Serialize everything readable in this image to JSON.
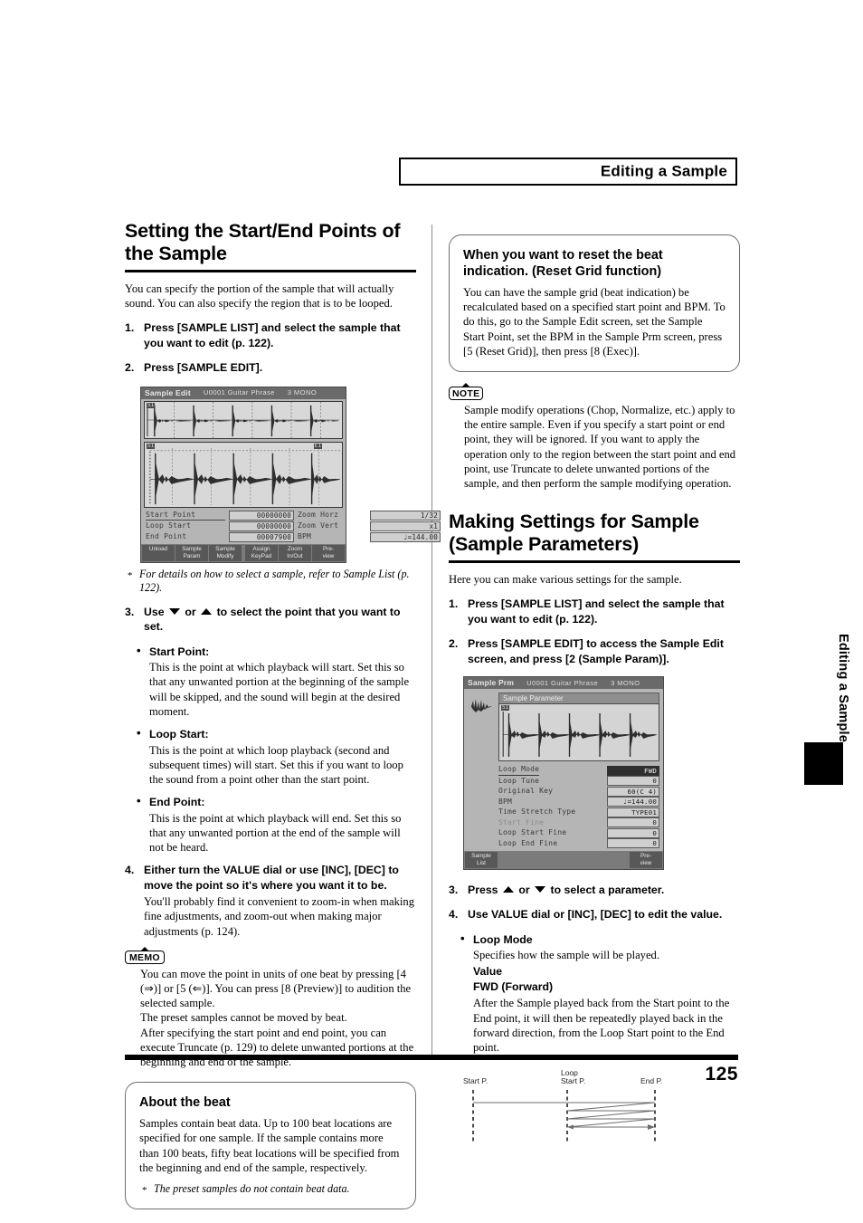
{
  "header": {
    "running_title": "Editing a Sample"
  },
  "thumb_tab": {
    "label": "Editing a Sample"
  },
  "footer": {
    "page_number": "125"
  },
  "left_column": {
    "section_title": "Setting the Start/End Points of the Sample",
    "intro": "You can specify the portion of the sample that will actually sound. You can also specify the region that is to be looped.",
    "step1": {
      "num": "1.",
      "text": "Press [SAMPLE LIST] and select the sample that you want to edit (p. 122)."
    },
    "step2": {
      "num": "2.",
      "text": "Press [SAMPLE EDIT]."
    },
    "lcd_sample_edit": {
      "title": "Sample Edit",
      "sample_name": "U0001 Guitar Phrase",
      "sample_mode": "3 MONO",
      "overview_marker_left": "S1",
      "detail_marker_left": "S1",
      "detail_marker_right": "E1",
      "params": [
        {
          "label": "Start Point",
          "value": "00000000",
          "selected": true
        },
        {
          "label": "Zoom Horz",
          "value": "1/32"
        },
        {
          "label": "Loop Start",
          "value": "00000000"
        },
        {
          "label": "Zoom Vert",
          "value": "x1"
        },
        {
          "label": "End Point",
          "value": "00007900"
        },
        {
          "label": "BPM",
          "value": "♩=144.00"
        }
      ],
      "softkeys": [
        "Unload",
        "Sample\nParam",
        "Sample\nModify",
        "",
        "Assign\nKeyPad",
        "Zoom\nIn/Out",
        "Pre-\nview"
      ]
    },
    "lcd_footnote": "For details on how to select a sample, refer to Sample List (p. 122).",
    "step3": {
      "num": "3.",
      "text_before": "Use",
      "text_middle": "or",
      "text_after": "to select the point that you want to set."
    },
    "bullets": [
      {
        "label": "Start Point:",
        "text": "This is the point at which playback will start. Set this so that any unwanted portion at the beginning of the sample will be skipped, and the sound will begin at the desired moment."
      },
      {
        "label": "Loop Start:",
        "text": "This is the point at which loop playback (second and subsequent times) will start. Set this if you want to loop the sound from a point other than the start point."
      },
      {
        "label": "End Point:",
        "text": "This is the point at which playback will end. Set this so that any unwanted portion at the end of the sample will not be heard."
      }
    ],
    "step4": {
      "num": "4.",
      "text": "Either turn the VALUE dial or use [INC], [DEC] to move the point so it's where you want it to be.",
      "body": "You'll probably find it convenient to zoom-in when making fine adjustments, and zoom-out when making major adjustments (p. 124)."
    },
    "memo": {
      "badge": "MEMO",
      "paragraphs": [
        "You can move the point in units of one beat by pressing [4 (⇒)] or [5 (⇐)]. You can press [8 (Preview)] to audition the selected sample.",
        "The preset samples cannot be moved by beat.",
        "After specifying the start point and end point, you can execute Truncate (p. 129) to delete unwanted portions at the beginning and end of the sample."
      ]
    },
    "about_beat": {
      "title": "About the beat",
      "body": "Samples contain beat data. Up to 100 beat locations are specified for one sample. If the sample contains more than 100 beats, fifty beat locations will be specified from the beginning and end of the sample, respectively.",
      "footnote": "The preset samples do not contain beat data."
    }
  },
  "right_column": {
    "reset_grid": {
      "title": "When you want to reset the beat indication. (Reset Grid function)",
      "body": "You can have the sample grid (beat indication) be recalculated based on a specified start point and BPM. To do this, go to the Sample Edit screen, set the Sample Start Point, set the BPM in the Sample Prm screen, press [5 (Reset Grid)], then press [8 (Exec)]."
    },
    "note": {
      "badge": "NOTE",
      "body": "Sample modify operations (Chop, Normalize, etc.) apply to the entire sample. Even if you specify a start point or end point, they will be ignored. If you want to apply the operation only to the region between the start point and end point, use Truncate to delete unwanted portions of the sample, and then perform the sample modifying operation."
    },
    "section_title": "Making Settings for Sample (Sample Parameters)",
    "intro": "Here you can make various settings for the sample.",
    "step1": {
      "num": "1.",
      "text": "Press [SAMPLE LIST] and select the sample that you want to edit (p. 122)."
    },
    "step2": {
      "num": "2.",
      "text": "Press [SAMPLE EDIT] to access the Sample Edit screen, and press [2 (Sample Param)]."
    },
    "lcd_sample_prm": {
      "title": "Sample Prm",
      "sample_name": "U0001 Guitar Phrase",
      "sample_mode": "3 MONO",
      "panel_title": "Sample Parameter",
      "wave_marker": "S1",
      "rows": [
        {
          "label": "Loop Mode",
          "value": "FWD",
          "selected": true
        },
        {
          "label": "Loop Tune",
          "value": "0"
        },
        {
          "label": "Original Key",
          "value": "60(C 4)"
        },
        {
          "label": "BPM",
          "value": "♩=144.00"
        },
        {
          "label": "Time Stretch Type",
          "value": "TYPE01"
        },
        {
          "label": "Start Fine",
          "value": "0",
          "dim": true
        },
        {
          "label": "Loop Start Fine",
          "value": "0"
        },
        {
          "label": "Loop End Fine",
          "value": "0"
        }
      ],
      "softkeys": [
        "Sample\nList",
        "",
        "Pre-\nview"
      ]
    },
    "step3": {
      "num": "3.",
      "text_before": "Press",
      "text_middle": "or",
      "text_after": "to select a parameter."
    },
    "step4": {
      "num": "4.",
      "text": "Use VALUE dial or [INC], [DEC] to edit the value."
    },
    "loop_mode": {
      "label": "Loop Mode",
      "desc": "Specifies how the sample will be played.",
      "value_heading": "Value",
      "fwd_heading": "FWD (Forward)",
      "fwd_desc": "After the Sample played back from the Start point to the End point, it will then be repeatedly played back in the forward direction, from the Loop Start point to the End point."
    },
    "loop_diagram": {
      "label_start": "Start P.",
      "label_loop_start_line1": "Loop",
      "label_loop_start_line2": "Start P.",
      "label_end": "End P."
    }
  }
}
